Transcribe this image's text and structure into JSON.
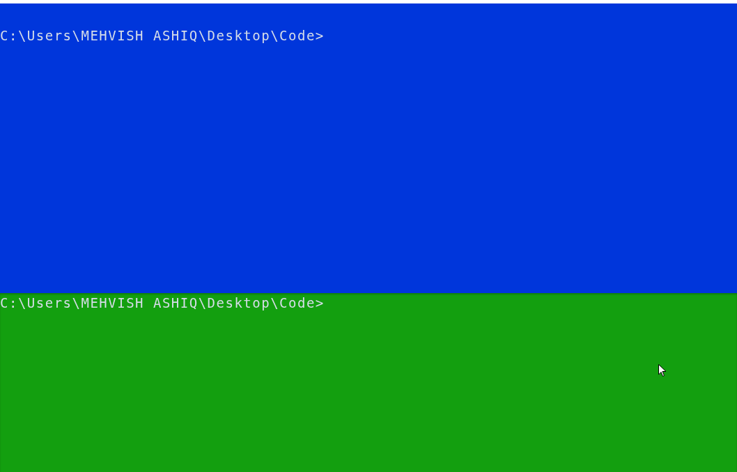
{
  "panes": [
    {
      "color": "#0036db",
      "prompt": "C:\\Users\\MEHVISH ASHIQ\\Desktop\\Code>"
    },
    {
      "color": "#139f0f",
      "prompt": "C:\\Users\\MEHVISH ASHIQ\\Desktop\\Code>"
    }
  ]
}
